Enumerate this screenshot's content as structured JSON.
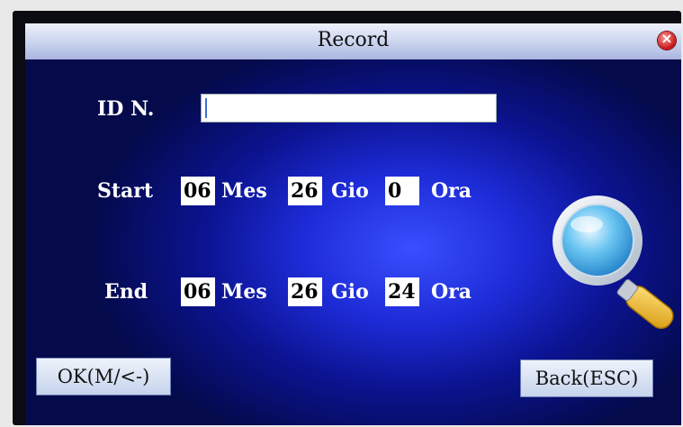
{
  "window": {
    "title": "Record"
  },
  "form": {
    "id_label": "ID N.",
    "id_value": "",
    "start": {
      "label": "Start",
      "month_value": "06",
      "month_unit": "Mes",
      "day_value": "26",
      "day_unit": "Gio",
      "hour_value": "0",
      "hour_unit": "Ora"
    },
    "end": {
      "label": "End",
      "month_value": "06",
      "month_unit": "Mes",
      "day_value": "26",
      "day_unit": "Gio",
      "hour_value": "24",
      "hour_unit": "Ora"
    }
  },
  "buttons": {
    "ok_label": "OK(M/<-)",
    "back_label": "Back(ESC)"
  },
  "icons": {
    "close": "close-icon",
    "search": "magnifier-icon"
  },
  "colors": {
    "screen_center": "#3a4fff",
    "screen_edge": "#040a4a",
    "titlebar": "#c9d3ee"
  }
}
